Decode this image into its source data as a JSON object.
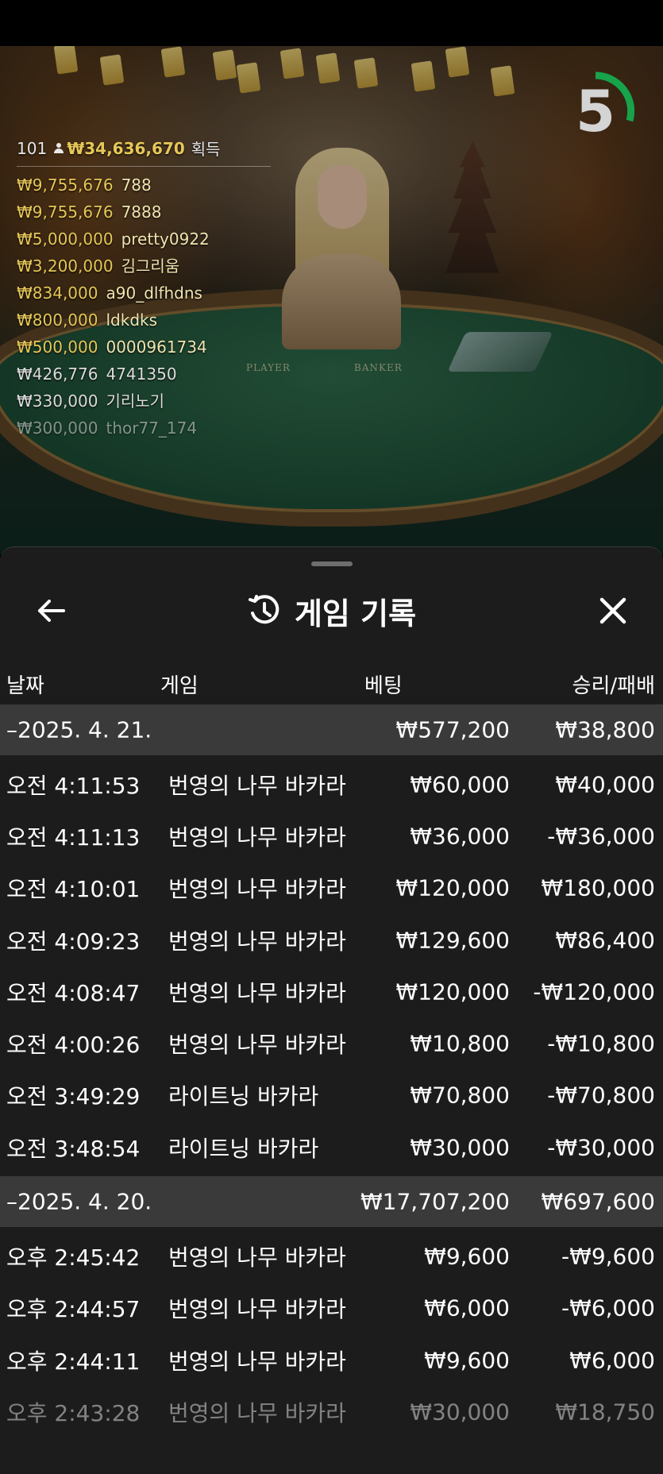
{
  "live": {
    "countdown": "5",
    "accent_color": "#17a34a",
    "felt_labels": {
      "player": "PLAYER",
      "banker": "BANKER"
    },
    "winners_header": {
      "players": "101",
      "total": "₩34,636,670",
      "suffix": "획득"
    },
    "winners": [
      {
        "amount": "₩9,755,676",
        "name": "788",
        "style": "gold"
      },
      {
        "amount": "₩9,755,676",
        "name": "7888",
        "style": "gold"
      },
      {
        "amount": "₩5,000,000",
        "name": "pretty0922",
        "style": "gold"
      },
      {
        "amount": "₩3,200,000",
        "name": "김그리움",
        "style": "gold"
      },
      {
        "amount": "₩834,000",
        "name": "a90_dlfhdns",
        "style": "gold"
      },
      {
        "amount": "₩800,000",
        "name": "ldkdks",
        "style": "gold"
      },
      {
        "amount": "₩500,000",
        "name": "0000961734",
        "style": "gold"
      },
      {
        "amount": "₩426,776",
        "name": "4741350",
        "style": "plain"
      },
      {
        "amount": "₩330,000",
        "name": "기리노기",
        "style": "plain"
      },
      {
        "amount": "₩300,000",
        "name": "thor77_174",
        "style": "plain fade"
      }
    ]
  },
  "sheet": {
    "title": "게임 기록",
    "title_icon": "history-icon",
    "back_icon": "arrow-left-icon",
    "close_icon": "close-icon",
    "columns": {
      "date": "날짜",
      "game": "게임",
      "bet": "베팅",
      "result": "승리/패배"
    },
    "groups": [
      {
        "date": "–2025. 4. 21.",
        "bet_total": "₩577,200",
        "result_total": "₩38,800",
        "rows": [
          {
            "time": "오전 4:11:53",
            "game": "번영의 나무 바카라",
            "bet": "₩60,000",
            "result": "₩40,000"
          },
          {
            "time": "오전 4:11:13",
            "game": "번영의 나무 바카라",
            "bet": "₩36,000",
            "result": "-₩36,000"
          },
          {
            "time": "오전 4:10:01",
            "game": "번영의 나무 바카라",
            "bet": "₩120,000",
            "result": "₩180,000"
          },
          {
            "time": "오전 4:09:23",
            "game": "번영의 나무 바카라",
            "bet": "₩129,600",
            "result": "₩86,400"
          },
          {
            "time": "오전 4:08:47",
            "game": "번영의 나무 바카라",
            "bet": "₩120,000",
            "result": "-₩120,000"
          },
          {
            "time": "오전 4:00:26",
            "game": "번영의 나무 바카라",
            "bet": "₩10,800",
            "result": "-₩10,800"
          },
          {
            "time": "오전 3:49:29",
            "game": "라이트닝 바카라",
            "bet": "₩70,800",
            "result": "-₩70,800"
          },
          {
            "time": "오전 3:48:54",
            "game": "라이트닝 바카라",
            "bet": "₩30,000",
            "result": "-₩30,000"
          }
        ]
      },
      {
        "date": "–2025. 4. 20.",
        "bet_total": "₩17,707,200",
        "result_total": "₩697,600",
        "rows": [
          {
            "time": "오후 2:45:42",
            "game": "번영의 나무 바카라",
            "bet": "₩9,600",
            "result": "-₩9,600"
          },
          {
            "time": "오후 2:44:57",
            "game": "번영의 나무 바카라",
            "bet": "₩6,000",
            "result": "-₩6,000"
          },
          {
            "time": "오후 2:44:11",
            "game": "번영의 나무 바카라",
            "bet": "₩9,600",
            "result": "₩6,000"
          },
          {
            "time": "오후 2:43:28",
            "game": "번영의 나무 바카라",
            "bet": "₩30,000",
            "result": "₩18,750"
          }
        ]
      }
    ]
  }
}
